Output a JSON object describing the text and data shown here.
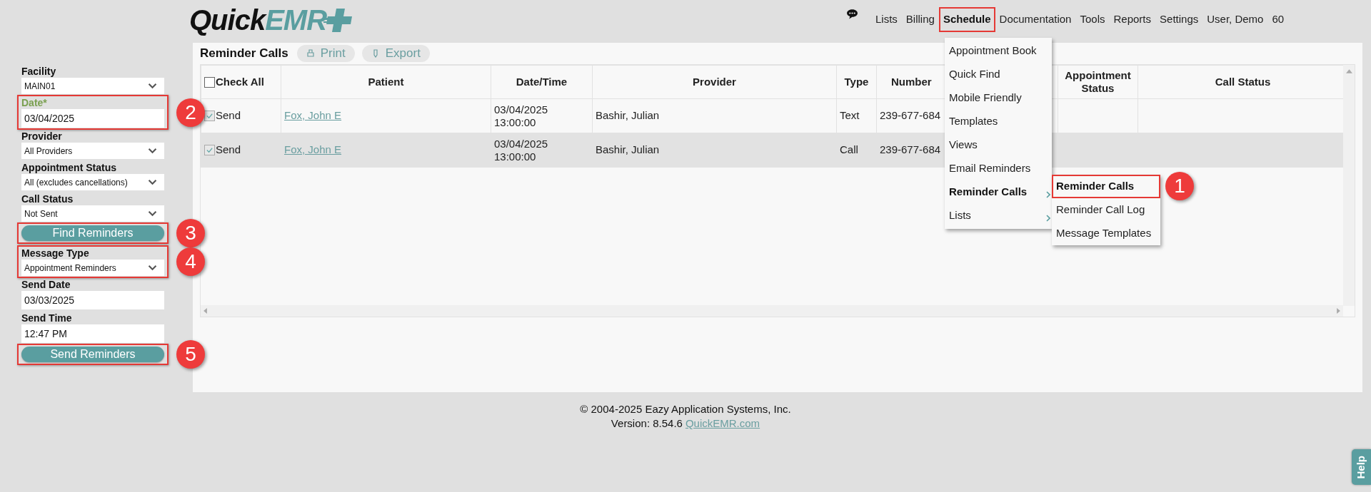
{
  "logo": {
    "part_1": "Quick",
    "part_2": "EMR"
  },
  "nav": [
    {
      "label": "Lists",
      "selected": false
    },
    {
      "label": "Billing",
      "selected": false
    },
    {
      "label": "Schedule",
      "selected": true
    },
    {
      "label": "Documentation",
      "selected": false
    },
    {
      "label": "Tools",
      "selected": false
    },
    {
      "label": "Reports",
      "selected": false
    },
    {
      "label": "Settings",
      "selected": false
    },
    {
      "label": "User, Demo",
      "selected": false
    },
    {
      "label": "60",
      "selected": false
    }
  ],
  "form": [
    {
      "kind": "select",
      "label": "Facility",
      "value": "MAIN01",
      "highlighted": false
    },
    {
      "kind": "input",
      "label": "Date*",
      "required": true,
      "value": "03/04/2025",
      "highlighted": true,
      "callout": "2"
    },
    {
      "kind": "select",
      "label": "Provider",
      "value": "All Providers",
      "highlighted": false
    },
    {
      "kind": "select",
      "label": "Appointment Status",
      "value": "All (excludes cancellations)",
      "highlighted": false
    },
    {
      "kind": "select",
      "label": "Call Status",
      "value": "Not Sent",
      "highlighted": false
    },
    {
      "kind": "button",
      "label": "Find Reminders",
      "highlighted": true,
      "callout": "3"
    },
    {
      "kind": "select",
      "label": "Message Type",
      "value": "Appointment Reminders",
      "highlighted": true,
      "callout": "4"
    },
    {
      "kind": "input",
      "label": "Send Date",
      "required": false,
      "value": "03/03/2025",
      "highlighted": false
    },
    {
      "kind": "input",
      "label": "Send Time",
      "required": false,
      "value": "12:47 PM",
      "highlighted": false
    },
    {
      "kind": "button",
      "label": "Send Reminders",
      "highlighted": true,
      "callout": "5"
    }
  ],
  "panel": {
    "title": "Reminder Calls",
    "buttons": [
      "Print",
      "Export"
    ]
  },
  "table": {
    "check_all": {
      "label": "Check All",
      "checked": false
    },
    "columns": [
      "Patient",
      "Date/Time",
      "Provider",
      "Type",
      "Number",
      "Appointment Status",
      "Call Status"
    ],
    "rows": [
      {
        "send": {
          "label": "Send",
          "checked": true
        },
        "patient": "Fox, John E",
        "date": "03/04/2025",
        "time": "13:00:00",
        "provider": "Bashir, Julian",
        "type": "Text",
        "number": "239-677-684"
      },
      {
        "send": {
          "label": "Send",
          "checked": true
        },
        "patient": "Fox, John E",
        "date": "03/04/2025",
        "time": "13:00:00",
        "provider": "Bashir, Julian",
        "type": "Call",
        "number": "239-677-684"
      }
    ]
  },
  "menu": {
    "items": [
      {
        "label": "Appointment Book",
        "bold": false,
        "submenu": false
      },
      {
        "label": "Quick Find",
        "bold": false,
        "submenu": false
      },
      {
        "label": "Mobile Friendly",
        "bold": false,
        "submenu": false
      },
      {
        "label": "Templates",
        "bold": false,
        "submenu": false
      },
      {
        "label": "Views",
        "bold": false,
        "submenu": false
      },
      {
        "label": "Email Reminders",
        "bold": false,
        "submenu": false
      },
      {
        "label": "Reminder Calls",
        "bold": true,
        "submenu": true
      },
      {
        "label": "Lists",
        "bold": false,
        "submenu": true
      }
    ],
    "submenu": [
      {
        "label": "Reminder Calls",
        "bold": true,
        "highlighted": true,
        "callout": "1"
      },
      {
        "label": "Reminder Call Log",
        "bold": false,
        "highlighted": false
      },
      {
        "label": "Message Templates",
        "bold": false,
        "highlighted": false
      }
    ]
  },
  "footer": {
    "copyright": "© 2004-2025 Eazy Application Systems, Inc.",
    "version": "Version: 8.54.6",
    "link": "QuickEMR.com"
  },
  "help": "Help"
}
